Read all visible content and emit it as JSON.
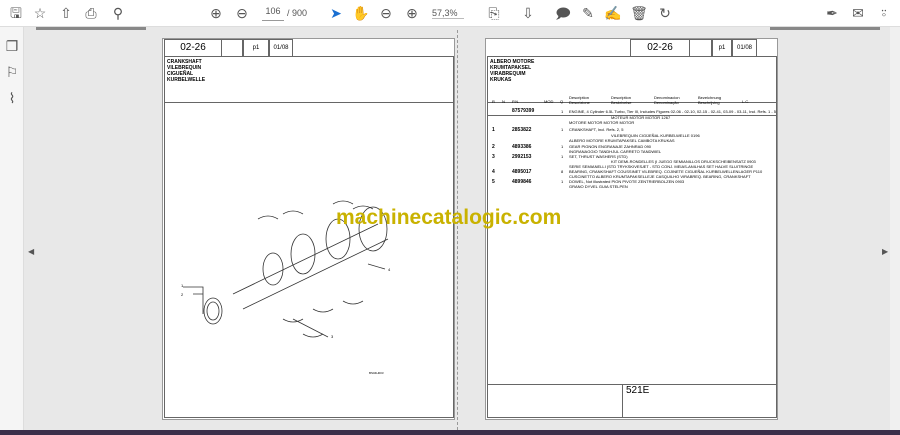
{
  "toolbar": {
    "left_icons": [
      "save-icon",
      "bookmark-star-icon",
      "upload-icon",
      "print-icon",
      "search-icon"
    ],
    "page_current": "106",
    "page_total": "/ 900",
    "zoom": "57,3%",
    "right_icons": [
      "sign-icon",
      "mail-icon",
      "account-icon"
    ]
  },
  "sidebar": {
    "icons": [
      "pages-icon",
      "bookmark-icon",
      "attachment-icon"
    ]
  },
  "left_page": {
    "code": "02-26",
    "p": "p1",
    "date": "01/08",
    "titles": [
      "CRANKSHAFT",
      "VILEBREQUIN",
      "CIGUEÑAL",
      "KURBELWELLE"
    ],
    "callouts": [
      "1",
      "2",
      "3",
      "4"
    ],
    "figure_id": "BS04H003"
  },
  "right_page": {
    "code": "02-26",
    "p": "p1",
    "date": "01/08",
    "titles": [
      "ALBERO MOTORE",
      "KRUMTAPAKSEL",
      "VIRABREQUIM",
      "KRUKAS"
    ],
    "columns": [
      "R",
      "N",
      "P.N.",
      "MOD",
      "Q",
      "Description Descrizione",
      "Description Beskrivelse",
      "Denominacion Denominação",
      "Bezeichnung Beschrijving",
      "L.C."
    ],
    "rows": [
      {
        "r": "",
        "pn": "87579399",
        "q": "1",
        "lines": [
          "ENGINE, 4 Cylinder 6.5L Turbo, Tier III, Includes Figures 02-06 - 02-10, 02-15 - 02-41, 03-09 - 03-11, Incl. Refs. 1 - 5",
          "MOTEUR   MOTOR   MOTOR   1267",
          "MOTORE   MOTOR   MOTOR   MOTOR"
        ]
      },
      {
        "r": "1",
        "pn": "2853822",
        "q": "1",
        "lines": [
          "CRANKSHAFT, Incl. Refs. 2, 5",
          "VILEBREQUIN   CIGÜEÑAL   KURBELWELLE   0196",
          "ALBERO MOTORE   KRUMTAPAKSEL   CAMBOTA   KRUKAS"
        ]
      },
      {
        "r": "2",
        "pn": "4893386",
        "q": "1",
        "lines": [
          "GEAR   PIGNON   ENGRANAJE   ZAHNRAD   090",
          "INGRANAGGIO   TANDHJUL   CARRETO   TANDWIEL"
        ]
      },
      {
        "r": "3",
        "pn": "2992153",
        "q": "1",
        "lines": [
          "SET, THRUST WASHERS (STD)",
          "KIT DEMI-RONDELLES (I   JUEGO SEMIANILLOS   DRUCKSCHEIBENSATZ   0903",
          "SERIE SEMIANELLI (STD   TRYKSKIVESÆT - STD   CONJ. MEIAS-ANILHAS   SET HALVE SLUITRINGE"
        ]
      },
      {
        "r": "4",
        "pn": "4895017",
        "q": "8",
        "lines": [
          "BEARING, CRANKSHAFT   COUSSINET VILEBREQ.   COJINETE CIGUEÑAL   KURBELWELLENLAGER   P110",
          "CUSCINETTO ALBERO   KRUMTAPAKSELLEJE   CASQUILHO VIRABREQ.   BEARING, CRANKSHAFT"
        ]
      },
      {
        "r": "5",
        "pn": "4899846",
        "q": "1",
        "lines": [
          "DOWEL, Not illustrated   PION   PIVOTE   ZENTRIERBOLZEN   0903",
          "GRANO   DYVEL   GUIA   STELPEN"
        ]
      }
    ],
    "footer_code": "521E"
  },
  "watermark": "machinecatalogic.com"
}
